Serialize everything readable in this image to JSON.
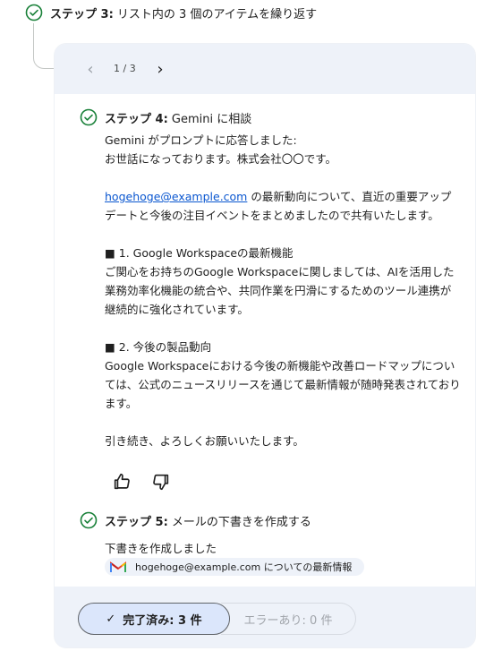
{
  "step3": {
    "prefix": "ステップ 3:",
    "text": " リスト内の 3 個のアイテムを繰り返す"
  },
  "pager": {
    "count": "1 / 3",
    "prev_icon": "chevron-left-icon",
    "next_icon": "chevron-right-icon"
  },
  "step4": {
    "prefix": "ステップ 4:",
    "text": " Gemini に相談"
  },
  "message": {
    "line1": "Gemini がプロンプトに応答しました:",
    "line2": "お世話になっております。株式会社〇〇です。",
    "link": "hogehoge@example.com",
    "para1_rest": " の最新動向について、直近の重要アップデートと今後の注目イベントをまとめましたので共有いたします。",
    "sec1_title": "■ 1. Google Workspaceの最新機能",
    "sec1_body": "ご関心をお持ちのGoogle Workspaceに関しましては、AIを活用した業務効率化機能の統合や、共同作業を円滑にするためのツール連携が継続的に強化されています。",
    "sec2_title": "■ 2. 今後の製品動向",
    "sec2_body": "Google Workspaceにおける今後の新機能や改善ロードマップについては、公式のニュースリリースを通じて最新情報が随時発表されております。",
    "closing": "引き続き、よろしくお願いいたします。"
  },
  "step5": {
    "prefix": "ステップ 5:",
    "text": " メールの下書きを作成する"
  },
  "draft": {
    "status": "下書きを作成しました",
    "chip_label": "hogehoge@example.com についての最新情報"
  },
  "footer": {
    "done_label": "完了済み: 3 件",
    "error_label": "エラーあり: 0 件"
  },
  "colors": {
    "accent": "#0b57d0",
    "check": "#188038",
    "card_bg": "#f8fafd",
    "chip_bg": "#eef2f9"
  }
}
